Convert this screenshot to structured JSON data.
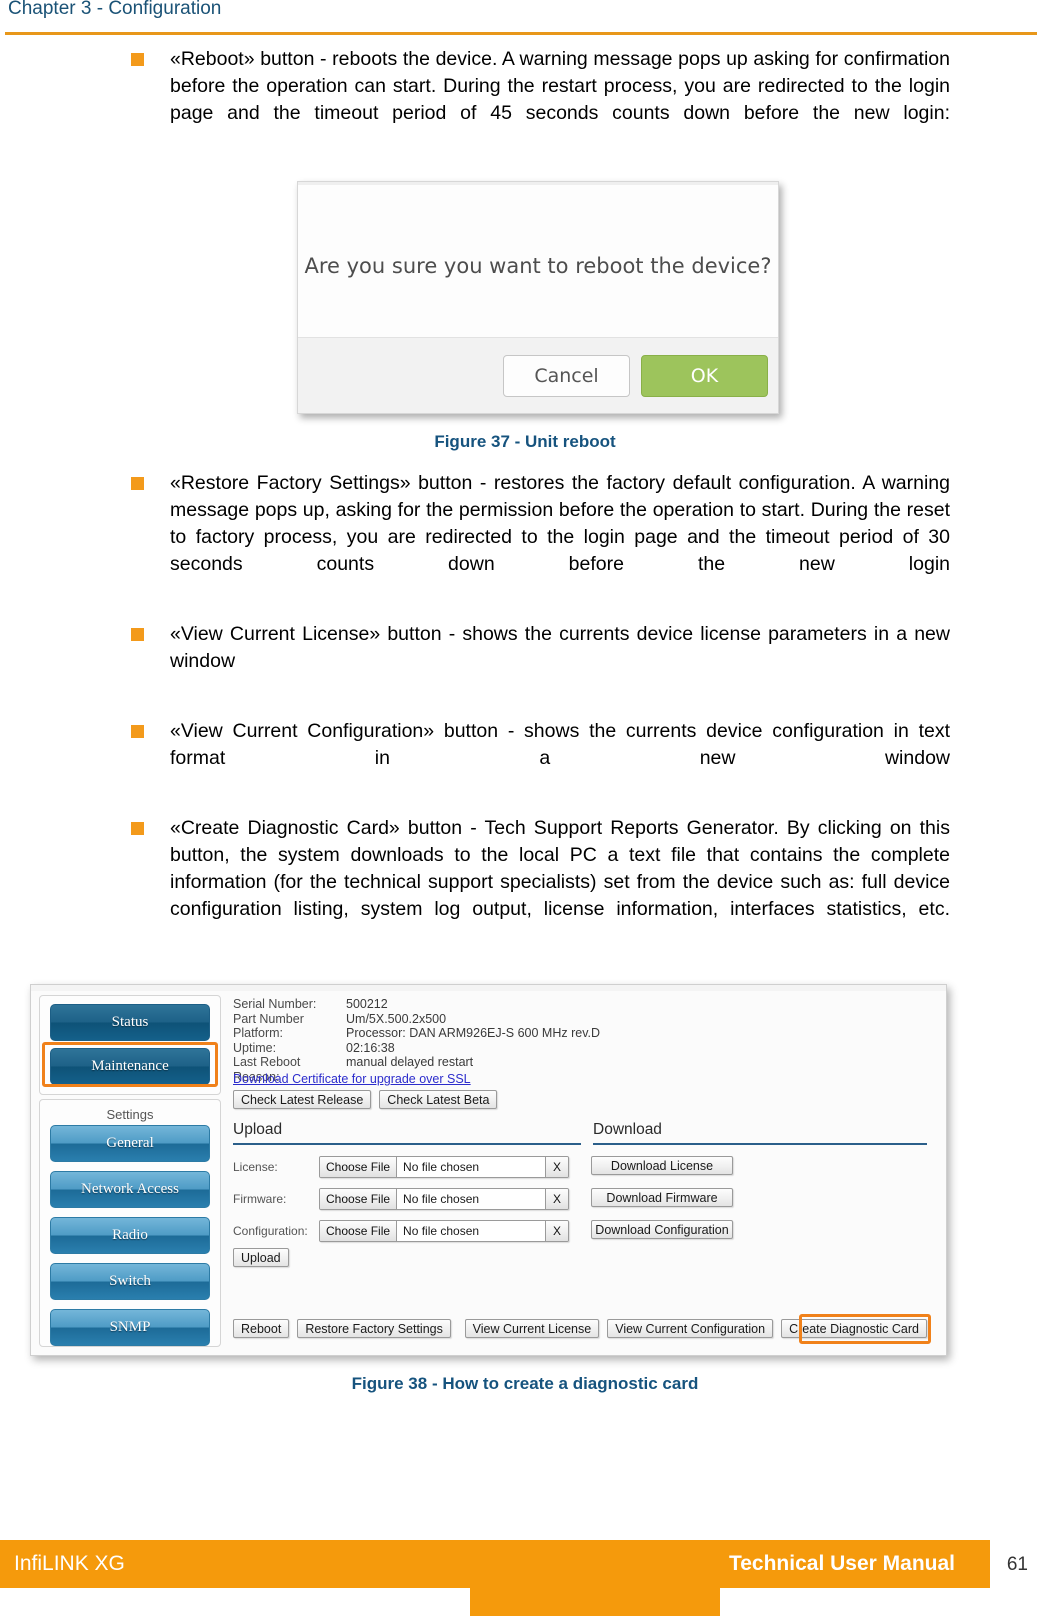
{
  "header": {
    "chapter_title": "Chapter 3 - Configuration",
    "rule_color": "#e8971a"
  },
  "bullets": [
    {
      "text": "«Reboot» button - reboots the device. A warning message pops up asking for confirmation before the operation can start. During the restart process, you are redirected to the login page and the timeout period of 45 seconds counts down before the new login:"
    },
    {
      "text": "«Restore Factory Settings» button - restores the factory default configuration. A warning message pops up, asking for the permission before the operation to start. During the reset to factory process, you are redirected to the login page and the timeout period of 30 seconds counts down before the new login"
    },
    {
      "text": " «View Current License» button - shows the currents device license parameters in a new window"
    },
    {
      "text": "«View Current Configuration» button - shows the currents device configuration in text format in a new window"
    },
    {
      "text": "«Create Diagnostic Card» button - Tech Support Reports Generator. By clicking on this button, the system downloads to the local PC a text file that contains the complete information (for the technical support specialists) set from the device such as: full device configuration listing, system log output, license information, interfaces statistics, etc."
    }
  ],
  "figure37": {
    "dialog": {
      "message": "Are you sure you want to reboot the device?",
      "cancel_label": "Cancel",
      "ok_label": "OK",
      "ok_color": "#9dc45c"
    },
    "caption": "Figure 37 - Unit reboot"
  },
  "figure38": {
    "caption": "Figure 38 - How to create a diagnostic card",
    "highlight_color": "#f0811a",
    "sidebar": {
      "top_items": [
        {
          "label": "Status",
          "highlighted": false
        },
        {
          "label": "Maintenance",
          "highlighted": true
        }
      ],
      "settings_label": "Settings",
      "settings_items": [
        {
          "label": "General"
        },
        {
          "label": "Network Access"
        },
        {
          "label": "Radio"
        },
        {
          "label": "Switch"
        },
        {
          "label": "SNMP"
        }
      ]
    },
    "device_info": [
      {
        "key": "Serial Number:",
        "value": "500212"
      },
      {
        "key": "Part Number",
        "value": "Um/5X.500.2x500"
      },
      {
        "key": "Platform:",
        "value": "Processor: DAN ARM926EJ-S 600 MHz rev.D"
      },
      {
        "key": "Uptime:",
        "value": "02:16:38"
      },
      {
        "key": "Last Reboot Reason:",
        "value": "manual delayed restart"
      }
    ],
    "ssl_link": "Download Certificate for upgrade over SSL",
    "check_buttons": [
      "Check Latest Release",
      "Check Latest Beta"
    ],
    "upload_section": {
      "heading": "Upload",
      "rows": [
        {
          "label": "License:",
          "choose": "Choose File",
          "file": "No file chosen",
          "clear": "X"
        },
        {
          "label": "Firmware:",
          "choose": "Choose File",
          "file": "No file chosen",
          "clear": "X"
        },
        {
          "label": "Configuration:",
          "choose": "Choose File",
          "file": "No file chosen",
          "clear": "X"
        }
      ],
      "upload_button": "Upload"
    },
    "download_section": {
      "heading": "Download",
      "buttons": [
        "Download License",
        "Download Firmware",
        "Download Configuration"
      ]
    },
    "bottom_buttons_left": [
      "Reboot",
      "Restore Factory Settings"
    ],
    "bottom_buttons_right": [
      "View Current License",
      "View Current Configuration",
      "Create Diagnostic Card"
    ]
  },
  "footer": {
    "product": "InfiLINK XG",
    "doc_title": "Technical User Manual",
    "page_number": "61",
    "bar_color": "#f59a0c"
  }
}
